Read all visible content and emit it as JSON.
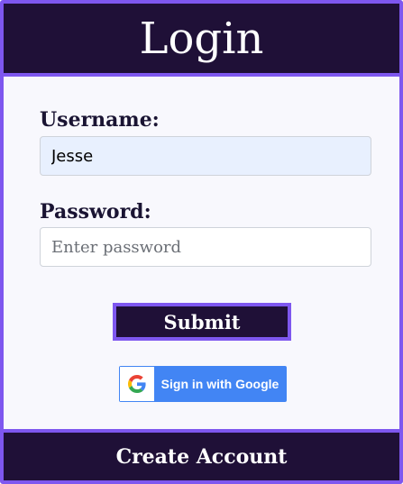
{
  "header": {
    "title": "Login"
  },
  "form": {
    "username_label": "Username:",
    "username_value": "Jesse",
    "password_label": "Password:",
    "password_placeholder": "Enter password",
    "submit_label": "Submit"
  },
  "google": {
    "label": "Sign in with Google",
    "icon": "google-g-icon"
  },
  "footer": {
    "create_account_label": "Create Account"
  },
  "colors": {
    "dark": "#1f1037",
    "accent": "#7e57ef",
    "google_blue": "#4285f4",
    "autofill_bg": "#e8f0fe"
  }
}
